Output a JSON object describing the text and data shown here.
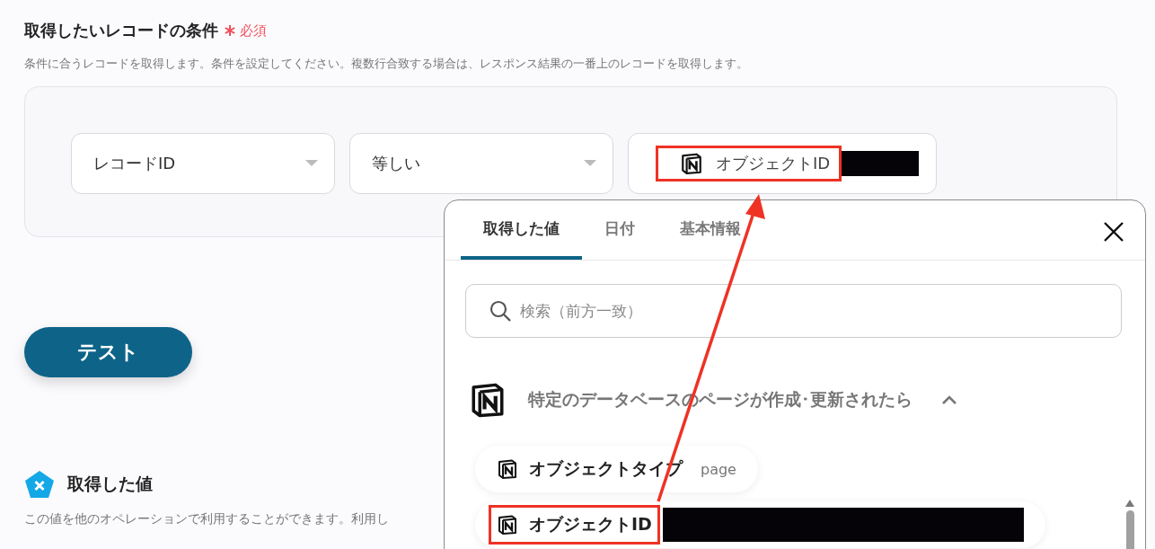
{
  "section": {
    "title": "取得したいレコードの条件",
    "required": "必須",
    "description": "条件に合うレコードを取得します。条件を設定してください。複数行合致する場合は、レスポンス結果の一番上のレコードを取得します。"
  },
  "condition": {
    "field": "レコードID",
    "operator": "等しい",
    "value_chip": {
      "label": "オブジェクトID",
      "highlighted": true
    }
  },
  "test_button": "テスト",
  "output": {
    "title": "取得した値",
    "description": "この値を他のオペレーションで利用することができます。利用し"
  },
  "popup": {
    "tabs": [
      {
        "label": "取得した値",
        "selected": true
      },
      {
        "label": "日付",
        "selected": false
      },
      {
        "label": "基本情報",
        "selected": false
      }
    ],
    "search": {
      "placeholder": "検索（前方一致）"
    },
    "group": {
      "title": "特定のデータベースのページが作成･更新されたら",
      "expanded": true,
      "items": [
        {
          "label": "オブジェクトタイプ",
          "value": "page",
          "redacted": false,
          "highlighted": false
        },
        {
          "label": "オブジェクトID",
          "redacted": true,
          "highlighted": true
        }
      ]
    }
  }
}
